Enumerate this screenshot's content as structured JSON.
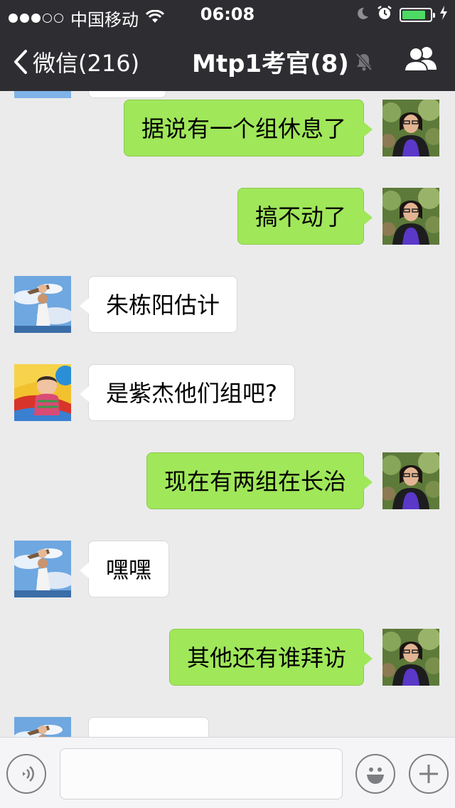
{
  "status_bar": {
    "carrier": "中国移动",
    "time": "06:08",
    "signal_strength": 3,
    "battery_level": 0.85,
    "battery_color": "#4cd964"
  },
  "nav": {
    "back_label": "微信(216)",
    "title": "Mtp1考官(8)",
    "icons": [
      "chevron-left-icon",
      "mute-bell-icon",
      "group-contacts-icon"
    ]
  },
  "messages": [
    {
      "sender": "me",
      "text": "据说有一个组休息了"
    },
    {
      "sender": "other",
      "text": "",
      "avatar": "sky-toddler"
    },
    {
      "sender": "me",
      "text": "搞不动了"
    },
    {
      "sender": "other",
      "text": "朱栋阳估计",
      "avatar": "sky-toddler"
    },
    {
      "sender": "other",
      "text": "是紫杰他们组吧?",
      "avatar": "baby-play"
    },
    {
      "sender": "me",
      "text": "现在有两组在长治"
    },
    {
      "sender": "other",
      "text": "嘿嘿",
      "avatar": "sky-toddler"
    },
    {
      "sender": "me",
      "text": "其他还有谁拜访"
    },
    {
      "sender": "other",
      "text": "",
      "avatar": "sky-toddler"
    }
  ],
  "input_bar": {
    "text_value": "",
    "icons": [
      "voice-icon",
      "emoji-icon",
      "plus-icon"
    ]
  },
  "colors": {
    "header": "#2e2e32",
    "chat_background": "#ebebeb",
    "my_bubble": "#a0e75a",
    "other_bubble": "#ffffff"
  }
}
